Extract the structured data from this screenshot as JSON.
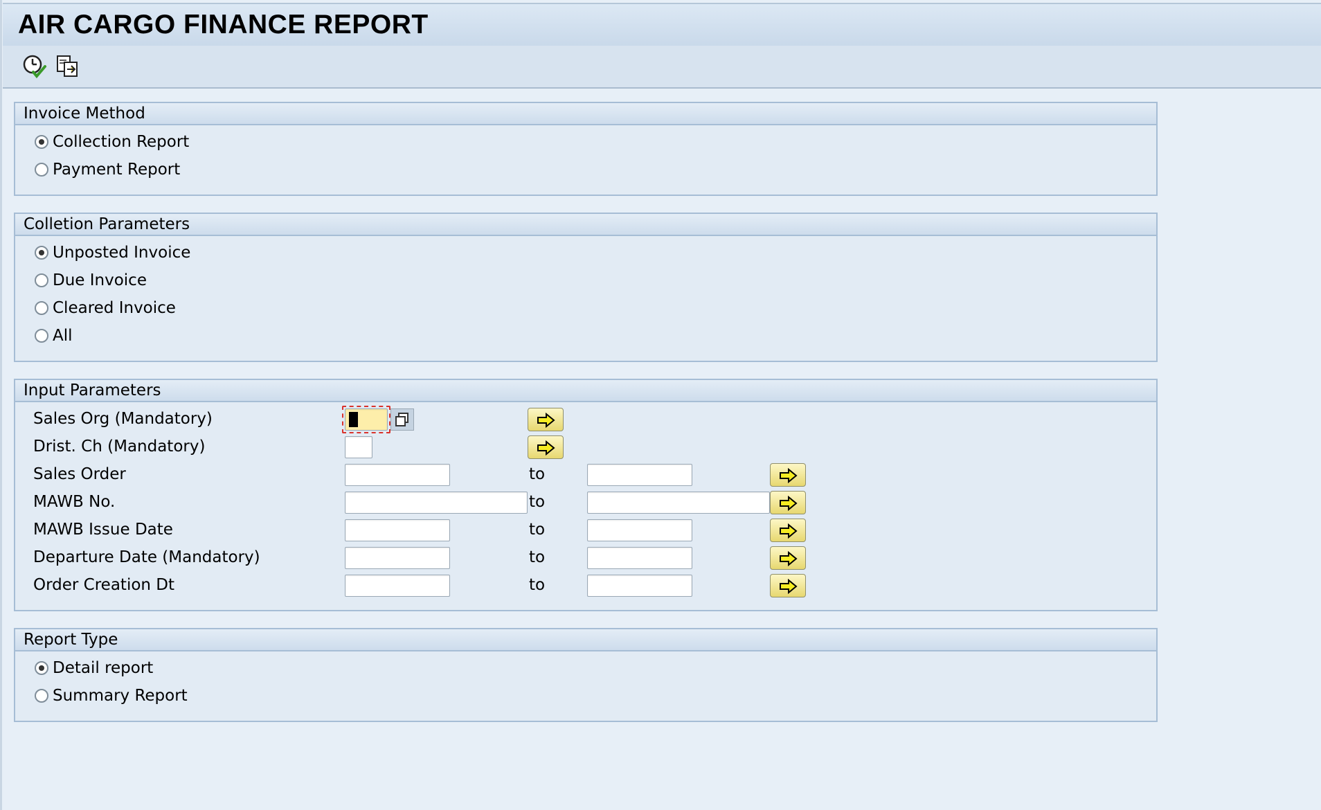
{
  "title": "AIR CARGO FINANCE REPORT",
  "toolbar": {
    "execute_icon": "clock-execute-icon",
    "variant_icon": "get-variant-icon"
  },
  "invoice_method": {
    "header": "Invoice Method",
    "options": [
      {
        "label": "Collection Report",
        "selected": true
      },
      {
        "label": "Payment Report",
        "selected": false
      }
    ]
  },
  "collection_parameters": {
    "header": "Colletion Parameters",
    "options": [
      {
        "label": "Unposted Invoice",
        "selected": true
      },
      {
        "label": "Due Invoice",
        "selected": false
      },
      {
        "label": "Cleared Invoice",
        "selected": false
      },
      {
        "label": "All",
        "selected": false
      }
    ]
  },
  "input_parameters": {
    "header": "Input Parameters",
    "to_label": "to",
    "rows": [
      {
        "label": "Sales Org (Mandatory)",
        "from": "",
        "to": null
      },
      {
        "label": "Drist. Ch (Mandatory)",
        "from": "",
        "to": null
      },
      {
        "label": "Sales Order",
        "from": "",
        "to": ""
      },
      {
        "label": "MAWB No.",
        "from": "",
        "to": ""
      },
      {
        "label": "MAWB Issue Date",
        "from": "",
        "to": ""
      },
      {
        "label": "Departure Date (Mandatory)",
        "from": "",
        "to": ""
      },
      {
        "label": "Order Creation Dt",
        "from": "",
        "to": ""
      }
    ]
  },
  "report_type": {
    "header": "Report Type",
    "options": [
      {
        "label": "Detail report",
        "selected": true
      },
      {
        "label": "Summary Report",
        "selected": false
      }
    ]
  },
  "colors": {
    "background": "#e7eff7",
    "group_border": "#a6bdd5",
    "focus_field": "#fdeeaa",
    "multi_select_button": "#f3e68c"
  }
}
